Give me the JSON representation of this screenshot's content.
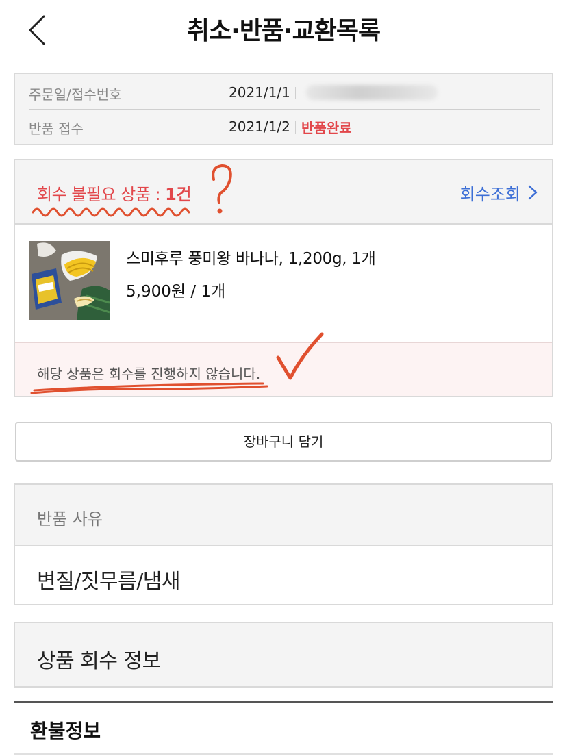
{
  "header": {
    "title": "취소·반품·교환목록",
    "back_icon": "chevron-left-icon"
  },
  "order_info": {
    "order_label": "주문일/접수번호",
    "order_date": "2021/1/1",
    "return_label": "반품 접수",
    "return_date": "2021/1/2",
    "status": "반품완료",
    "status_color": "#e2474b"
  },
  "pickup_section": {
    "label_prefix": "회수 불필요 상품 : ",
    "count": "1건",
    "link_label": "회수조회",
    "link_color": "#3d6fd6"
  },
  "product": {
    "name": "스미후루 풍미왕 바나나, 1,200g, 1개",
    "price": "5,900원 / 1개",
    "image": "banana-product-image"
  },
  "notice": {
    "text": "해당 상품은 회수를 진행하지 않습니다."
  },
  "cart_button": {
    "label": "장바구니 담기"
  },
  "reason": {
    "label": "반품 사유",
    "value": "변질/짓무름/냄새"
  },
  "pickup_info": {
    "label": "상품 회수 정보"
  },
  "refund": {
    "title": "환불정보"
  },
  "annotations": {
    "marks": [
      "question-mark",
      "check-mark",
      "wavy-underline",
      "underline"
    ],
    "color": "#e0502f"
  }
}
